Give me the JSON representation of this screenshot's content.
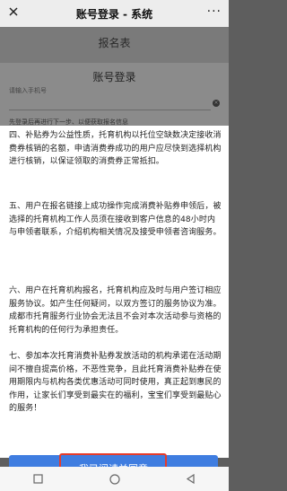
{
  "top_bar": {
    "close_icon": "close-icon",
    "title": "账号登录 - 系统",
    "more_label": "···"
  },
  "form": {
    "header": "报名表",
    "login_title": "账号登录",
    "phone_label": "请输入手机号",
    "phone_value": "",
    "clear_icon": "×",
    "hint": "先登录后再进行下一步、以便获取报名信息"
  },
  "terms": {
    "p4": "四、补贴券为公益性质，托育机构以托位空缺数决定接收消费券核销的名额，申请消费券成功的用户应尽快到选择机构进行核销，以保证领取的消费券正常抵扣。",
    "p5": "五、用户在报名链接上成功操作完成消费补贴券申领后，被选择的托育机构工作人员须在接收到客户信息的48小时内与申领者联系，介绍机构相关情况及接受申领者咨询服务。",
    "p6": "六、用户在托育机构报名，托育机构应及时与用户签订相应服务协议。如产生任何疑问，以双方签订的服务协议为准。成都市托育服务行业协会无法且不会对本次活动参与资格的托育机构的任何行为承担责任。",
    "p7": "七、参加本次托育消费补贴券发放活动的机构承诺在活动期间不擅自提高价格，不恶性竞争，且此托育消费补贴券在使用期限内与机构各类优惠活动可同时使用，真正起到惠民的作用，让家长们享受到最实在的福利，宝宝们享受到最贴心的服务！"
  },
  "agree_button": "我已阅读并同意",
  "colors": {
    "accent": "#3f7de0",
    "highlight": "#e63b2a"
  },
  "nav": {
    "icons": [
      "square-icon",
      "circle-icon",
      "back-triangle-icon"
    ]
  }
}
